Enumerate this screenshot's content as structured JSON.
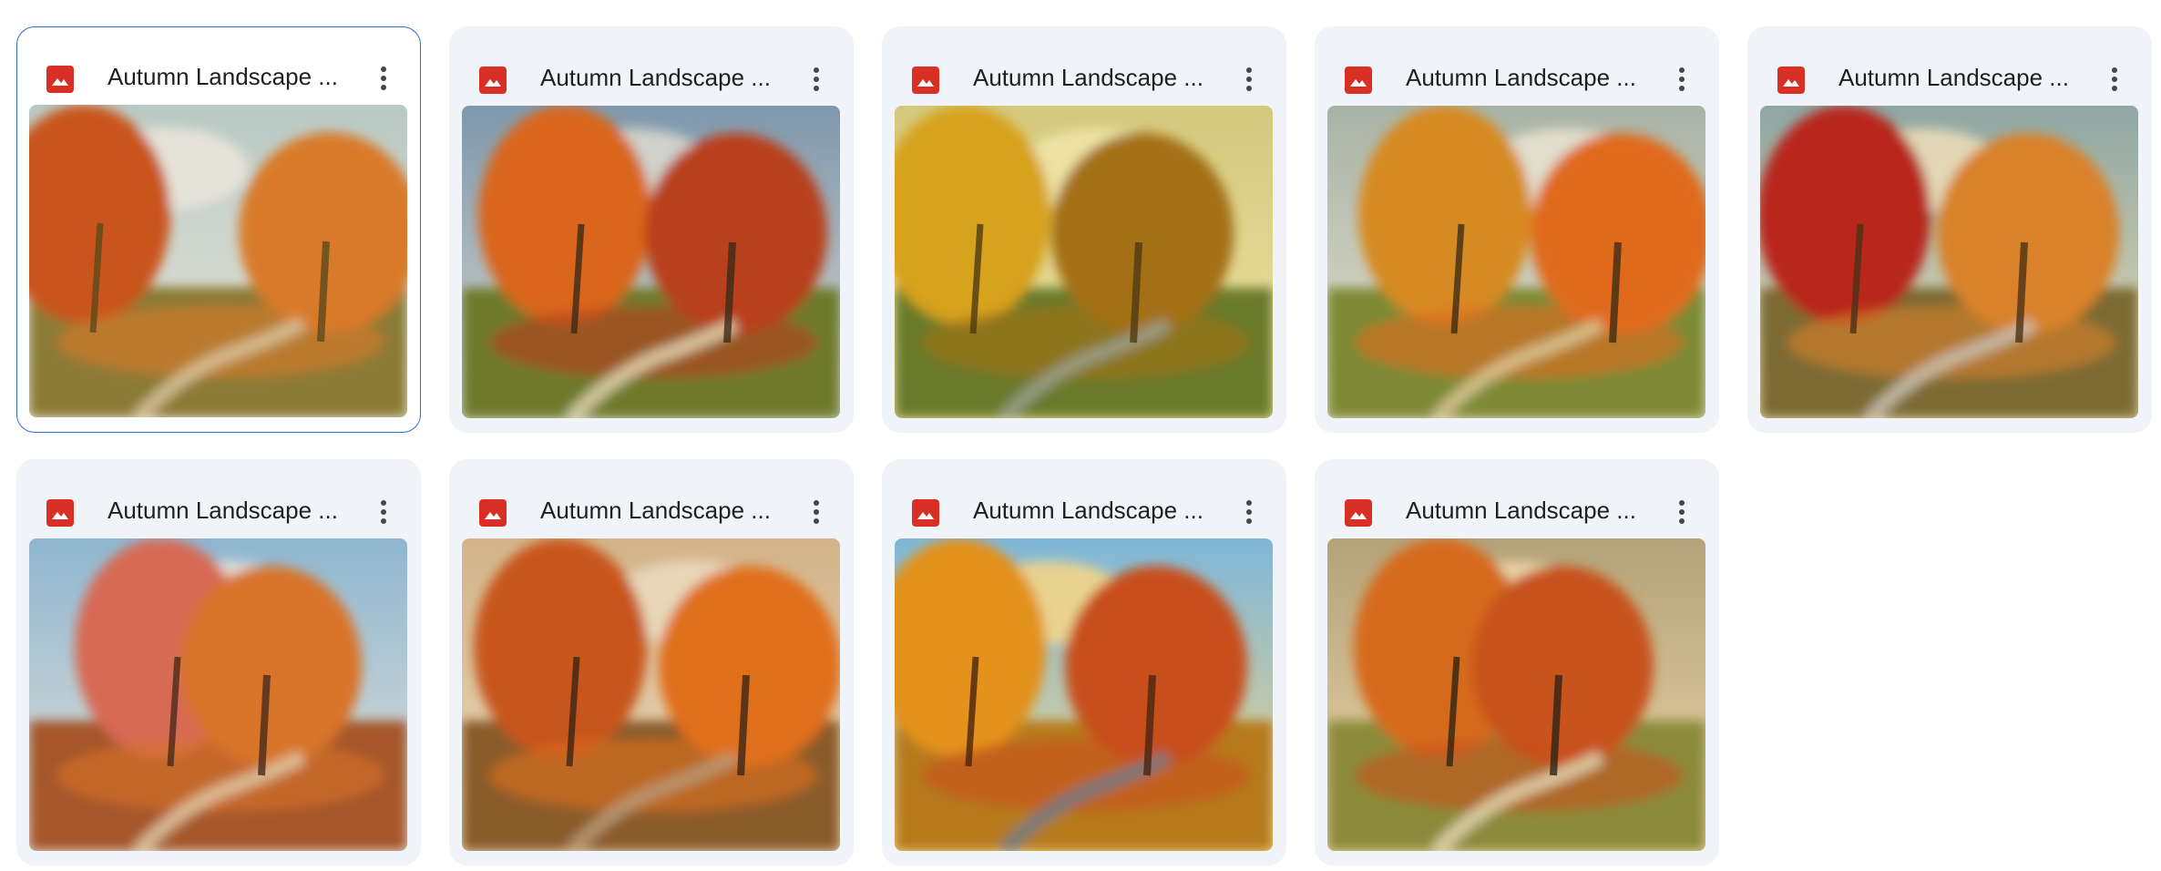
{
  "files": [
    {
      "title": "Autumn Landscape ...",
      "icon": "image-file-icon",
      "selected": true,
      "palette": {
        "sky": "#b9c9c4",
        "cloud": "#e9e6da",
        "tree1": "#c9541b",
        "tree2": "#d87a2a",
        "ground": "#8a7a36",
        "path": "#d8c49a",
        "accent": "#5c4a1c"
      }
    },
    {
      "title": "Autumn Landscape ...",
      "icon": "image-file-icon",
      "selected": false,
      "palette": {
        "sky": "#7f98ad",
        "cloud": "#d7d6cd",
        "tree1": "#d9661f",
        "tree2": "#b8401a",
        "ground": "#6e7a2c",
        "path": "#e2d4b2",
        "accent": "#3b2b18"
      }
    },
    {
      "title": "Autumn Landscape ...",
      "icon": "image-file-icon",
      "selected": false,
      "palette": {
        "sky": "#d3c87c",
        "cloud": "#eee4a7",
        "tree1": "#d7a21c",
        "tree2": "#a46f12",
        "ground": "#6b7a2b",
        "path": "#9aa08c",
        "accent": "#4e3b12"
      }
    },
    {
      "title": "Autumn Landscape ...",
      "icon": "image-file-icon",
      "selected": false,
      "palette": {
        "sky": "#a8b3a7",
        "cloud": "#e6e1cf",
        "tree1": "#d78a24",
        "tree2": "#e06a1f",
        "ground": "#7e8a34",
        "path": "#d9c694",
        "accent": "#3d2d16"
      }
    },
    {
      "title": "Autumn Landscape ...",
      "icon": "image-file-icon",
      "selected": false,
      "palette": {
        "sky": "#8fa7a3",
        "cloud": "#e9dcb8",
        "tree1": "#b8281b",
        "tree2": "#d9822c",
        "ground": "#7b6a30",
        "path": "#c9c0b0",
        "accent": "#4a3216"
      }
    },
    {
      "title": "Autumn Landscape ...",
      "icon": "image-file-icon",
      "selected": false,
      "palette": {
        "sky": "#8fb6d0",
        "cloud": "#e4e2d8",
        "tree1": "#d76a55",
        "tree2": "#d8742a",
        "ground": "#a5562c",
        "path": "#e0c8a4",
        "accent": "#4a2a1c"
      }
    },
    {
      "title": "Autumn Landscape ...",
      "icon": "image-file-icon",
      "selected": false,
      "palette": {
        "sky": "#d3b48a",
        "cloud": "#ead9bc",
        "tree1": "#c8561c",
        "tree2": "#e0701f",
        "ground": "#8a5c2a",
        "path": "#b89a76",
        "accent": "#3b2616"
      }
    },
    {
      "title": "Autumn Landscape ...",
      "icon": "image-file-icon",
      "selected": false,
      "palette": {
        "sky": "#7fb7d8",
        "cloud": "#f2d58a",
        "tree1": "#e3921e",
        "tree2": "#c8501a",
        "ground": "#b67a1c",
        "path": "#6d7d8a",
        "accent": "#4a2410"
      }
    },
    {
      "title": "Autumn Landscape ...",
      "icon": "image-file-icon",
      "selected": false,
      "palette": {
        "sky": "#b4a27a",
        "cloud": "#ecd6a6",
        "tree1": "#d66a1e",
        "tree2": "#c8521a",
        "ground": "#8b8a3a",
        "path": "#e2d6b2",
        "accent": "#2e2414"
      }
    }
  ]
}
